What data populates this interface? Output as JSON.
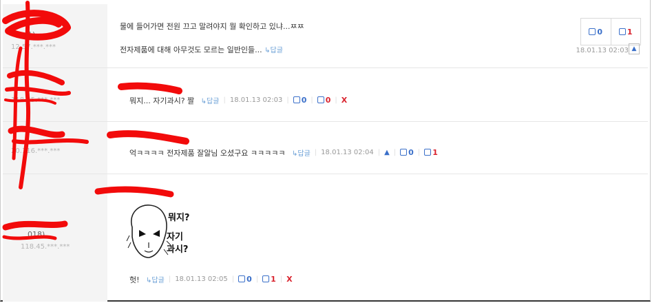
{
  "comments": [
    {
      "nick": "1)",
      "ip": "12.57.***.***",
      "text": "물에 들어가면 전원 끄고 말려야지 뭘 확인하고 있냐...ㅉㅉ",
      "parent_snippet": "전자제품에 대해 아무것도 모르는 일반인들...",
      "reply_label": "↳답글",
      "date": "18.01.13 02:03",
      "up": "0",
      "down": "1"
    },
    {
      "nick": "",
      "ip": "118.45.***.***",
      "text": "뭐지... 자기과시? 짤",
      "reply_label": "↳답글",
      "date": "18.01.13 02:03",
      "up": "0",
      "down": "0",
      "delete": "X"
    },
    {
      "nick": "",
      "ip": "20.116.***.***",
      "text": "억ㅋㅋㅋㅋ 전자제품 잘알님 오셨구요 ㅋㅋㅋㅋㅋ",
      "reply_label": "↳답글",
      "date": "18.01.13 02:04",
      "up": "0",
      "down": "1"
    },
    {
      "nick": "018)",
      "ip": "118.45.***.***",
      "text": "헛!",
      "reply_label": "↳답글",
      "date": "18.01.13 02:05",
      "up": "0",
      "down": "1",
      "delete": "X",
      "image_text": [
        "뭐지?",
        "자기",
        "과시?"
      ]
    }
  ],
  "colors": {
    "up": "#3a6fc9",
    "down": "#d9232e",
    "redaction": "#f20b0b",
    "left_bg": "#f4f4f4"
  },
  "icons": [
    "thumbs-up-icon",
    "thumbs-down-icon",
    "bell-icon",
    "reply-arrow-icon"
  ]
}
